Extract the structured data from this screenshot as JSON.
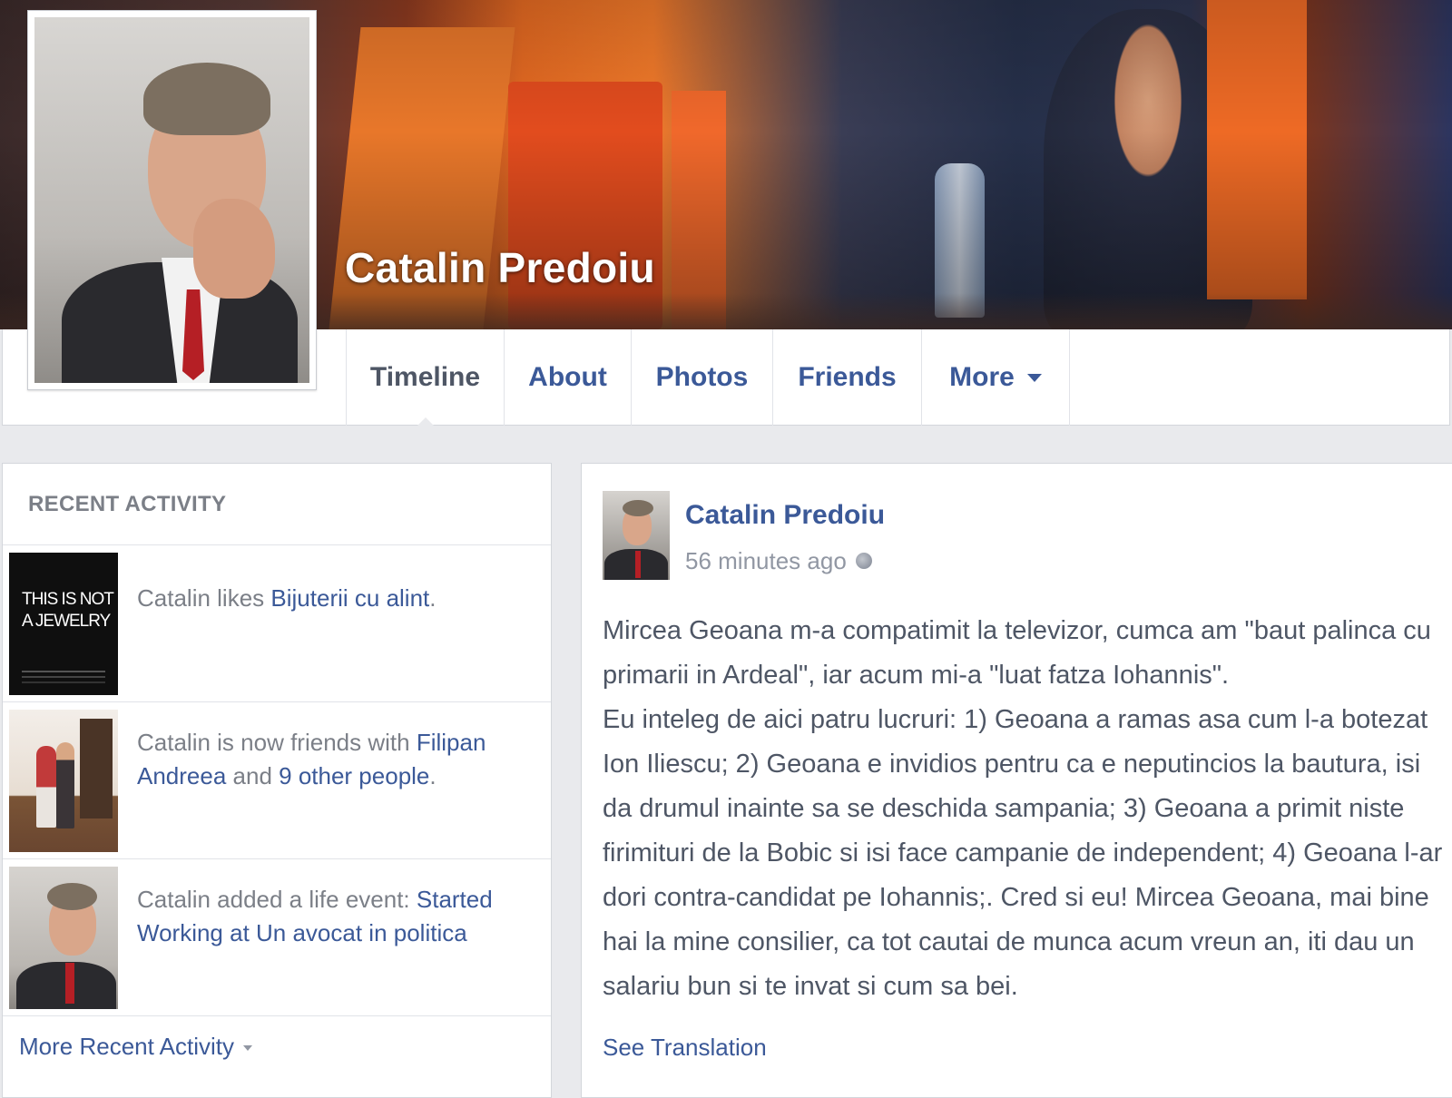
{
  "profile": {
    "name": "Catalin Predoiu"
  },
  "tabs": [
    {
      "label": "Timeline",
      "active": true
    },
    {
      "label": "About",
      "active": false
    },
    {
      "label": "Photos",
      "active": false
    },
    {
      "label": "Friends",
      "active": false
    },
    {
      "label": "More",
      "active": false
    }
  ],
  "recent_activity": {
    "header": "RECENT ACTIVITY",
    "items": [
      {
        "thumb_text": "THIS IS NOT A JEWELRY",
        "prefix": "Catalin likes ",
        "link": "Bijuterii cu alint",
        "suffix": "."
      },
      {
        "prefix": "Catalin is now friends with ",
        "link": "Filipan Andreea",
        "middle": " and ",
        "link2": "9 other people",
        "suffix": "."
      },
      {
        "prefix": "Catalin added a life event: ",
        "link": "Started Working at Un avocat in politica"
      }
    ],
    "more_label": "More Recent Activity"
  },
  "post": {
    "author": "Catalin Predoiu",
    "time": "56 minutes ago",
    "body_1": "Mircea Geoana m-a compatimit la televizor, cumca am \"baut palinca cu primarii in Ardeal\", iar acum mi-a \"luat fatza Iohannis\".",
    "body_2": "Eu inteleg de aici patru lucruri: 1) Geoana a ramas asa cum l-a botezat Ion Iliescu; 2) Geoana e invidios pentru ca e neputincios la bautura, isi da drumul inainte sa se deschida sampania; 3) Geoana a primit niste firimituri de la Bobic si isi face campanie de independent; 4) Geoana l-ar dori contra-candidat pe Iohannis;. Cred si eu! Mircea Geoana, mai bine hai la mine consilier, ca tot cautai de munca acum vreun an, iti dau un salariu bun si te invat si cum sa bei.",
    "see_translation": "See Translation"
  },
  "colors": {
    "link": "#3b5998",
    "muted_text": "#9197a3",
    "body_text": "#4e5665",
    "page_bg": "#e9eaed"
  }
}
